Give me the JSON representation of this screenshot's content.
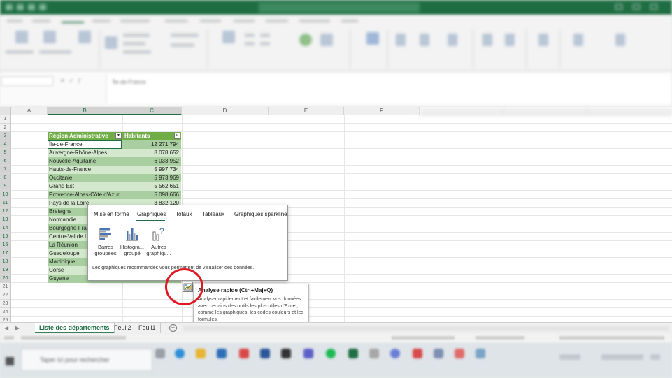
{
  "excel": {
    "formula_value": "Île-de-France",
    "columns": [
      "A",
      "B",
      "C",
      "D",
      "E",
      "F"
    ],
    "rows": [
      "1",
      "2",
      "3",
      "4",
      "5",
      "6",
      "7",
      "8",
      "9",
      "10",
      "11",
      "12",
      "13",
      "14",
      "15",
      "16",
      "17",
      "18",
      "19",
      "20",
      "21",
      "22",
      "23",
      "24",
      "25"
    ],
    "table": {
      "headers": [
        "Région Administrative",
        "Habitants"
      ],
      "filter_icons": [
        "▾",
        "↵"
      ],
      "records": [
        [
          "Île-de-France",
          "12 271 794"
        ],
        [
          "Auvergne-Rhône-Alpes",
          "8 078 652"
        ],
        [
          "Nouvelle-Aquitaine",
          "6 033 952"
        ],
        [
          "Hauts-de-France",
          "5 997 734"
        ],
        [
          "Occitanie",
          "5 973 969"
        ],
        [
          "Grand Est",
          "5 562 651"
        ],
        [
          "Provence-Alpes-Côte d'Azur",
          "5 098 666"
        ],
        [
          "Pays de la Loire",
          "3 832 120"
        ],
        [
          "Bretagne",
          ""
        ],
        [
          "Normandie",
          ""
        ],
        [
          "Bourgogne-Franche-Comté",
          ""
        ],
        [
          "Centre-Val de Loire",
          ""
        ],
        [
          "La Réunion",
          ""
        ],
        [
          "Guadeloupe",
          ""
        ],
        [
          "Martinique",
          ""
        ],
        [
          "Corse",
          ""
        ],
        [
          "Guyane",
          ""
        ]
      ]
    },
    "sheets": [
      "Liste des départements",
      "Feuil2",
      "Feuil1"
    ],
    "add_sheet": "+",
    "nav_arrows": [
      "◀",
      "▶"
    ]
  },
  "quick_analysis": {
    "tabs": [
      "Mise en forme",
      "Graphiques",
      "Totaux",
      "Tableaux",
      "Graphiques sparkline"
    ],
    "active_tab": "Graphiques",
    "items": [
      {
        "line1": "Barres",
        "line2": "groupées"
      },
      {
        "line1": "Histogra...",
        "line2": "groupé"
      },
      {
        "line1": "Autres",
        "line2": "graphiqu..."
      }
    ],
    "description": "Les graphiques recommandés vous permettent de visualiser des données.",
    "tooltip_title": "Analyse rapide (Ctrl+Maj+Q)",
    "tooltip_body": "Analyser rapidement et facilement vos données avec certains des outils les plus utiles d'Excel, comme les graphiques, les codes couleurs et les formules."
  },
  "taskbar": {
    "search_placeholder": "Taper ici pour rechercher"
  },
  "colors": {
    "excel_green": "#1f6e43",
    "table_header": "#70ad47",
    "band_dark": "#a9cfa0",
    "band_light": "#d4e8cd",
    "highlight": "#e01822"
  }
}
